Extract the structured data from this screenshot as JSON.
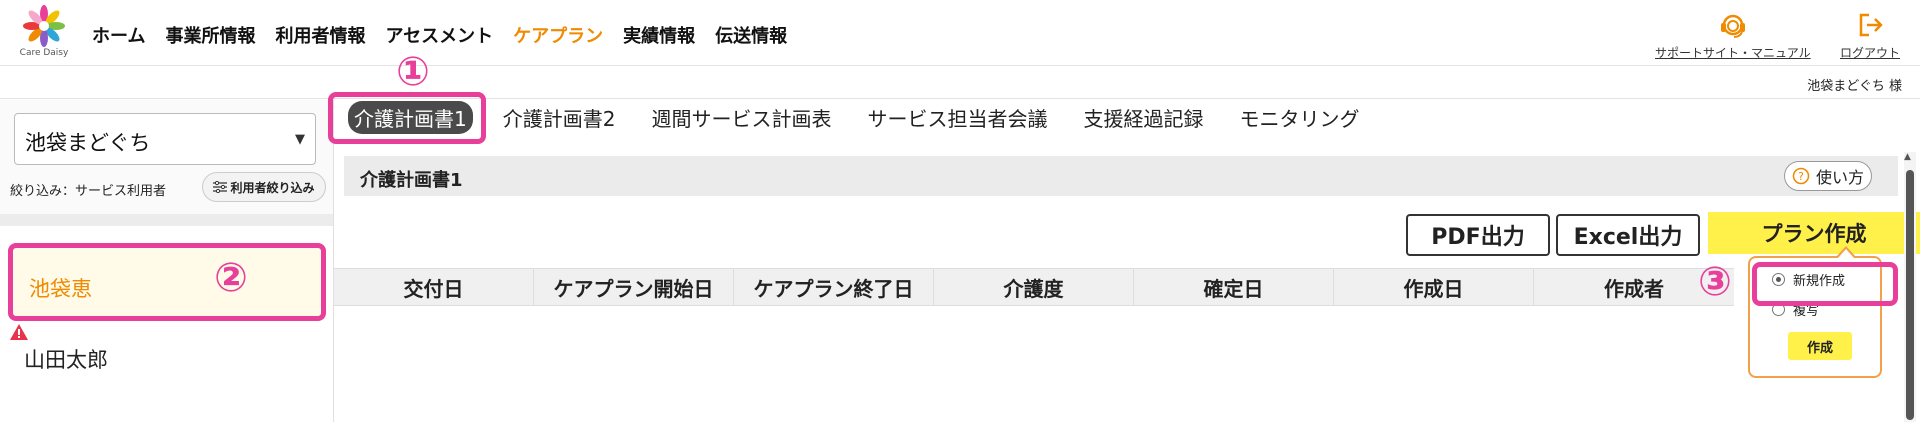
{
  "header": {
    "logo_text": "Care Daisy",
    "nav": [
      {
        "label": "ホーム",
        "active": false
      },
      {
        "label": "事業所情報",
        "active": false
      },
      {
        "label": "利用者情報",
        "active": false
      },
      {
        "label": "アセスメント",
        "active": false
      },
      {
        "label": "ケアプラン",
        "active": true
      },
      {
        "label": "実績情報",
        "active": false
      },
      {
        "label": "伝送情報",
        "active": false
      }
    ],
    "support_label": "サポートサイト・マニュアル",
    "logout_label": "ログアウト",
    "user_name": "池袋まどぐち 様",
    "accent_color": "#f08a00"
  },
  "sidebar": {
    "office_select": "池袋まどぐち",
    "filter_label": "絞り込み：サービス利用者",
    "filter_button": "利用者絞り込み",
    "clients": [
      {
        "name": "池袋恵",
        "selected": true
      },
      {
        "name": "山田太郎",
        "selected": false,
        "warning": true
      }
    ]
  },
  "tabs": [
    {
      "label": "介護計画書1",
      "active": true
    },
    {
      "label": "介護計画書2",
      "active": false
    },
    {
      "label": "週間サービス計画表",
      "active": false
    },
    {
      "label": "サービス担当者会議",
      "active": false
    },
    {
      "label": "支援経過記録",
      "active": false
    },
    {
      "label": "モニタリング",
      "active": false
    }
  ],
  "main": {
    "title": "介護計画書1",
    "howto_label": "使い方",
    "pdf_button": "PDF出力",
    "excel_button": "Excel出力",
    "plan_button": "プラン作成",
    "columns": [
      "交付日",
      "ケアプラン開始日",
      "ケアプラン終了日",
      "介護度",
      "確定日",
      "作成日",
      "作成者"
    ]
  },
  "popover": {
    "options": [
      {
        "label": "新規作成",
        "checked": true
      },
      {
        "label": "複写",
        "checked": false
      }
    ],
    "create_button": "作成"
  },
  "annotations": {
    "marker_1": "①",
    "marker_2": "②",
    "marker_3": "③",
    "color": "#e8409a"
  }
}
